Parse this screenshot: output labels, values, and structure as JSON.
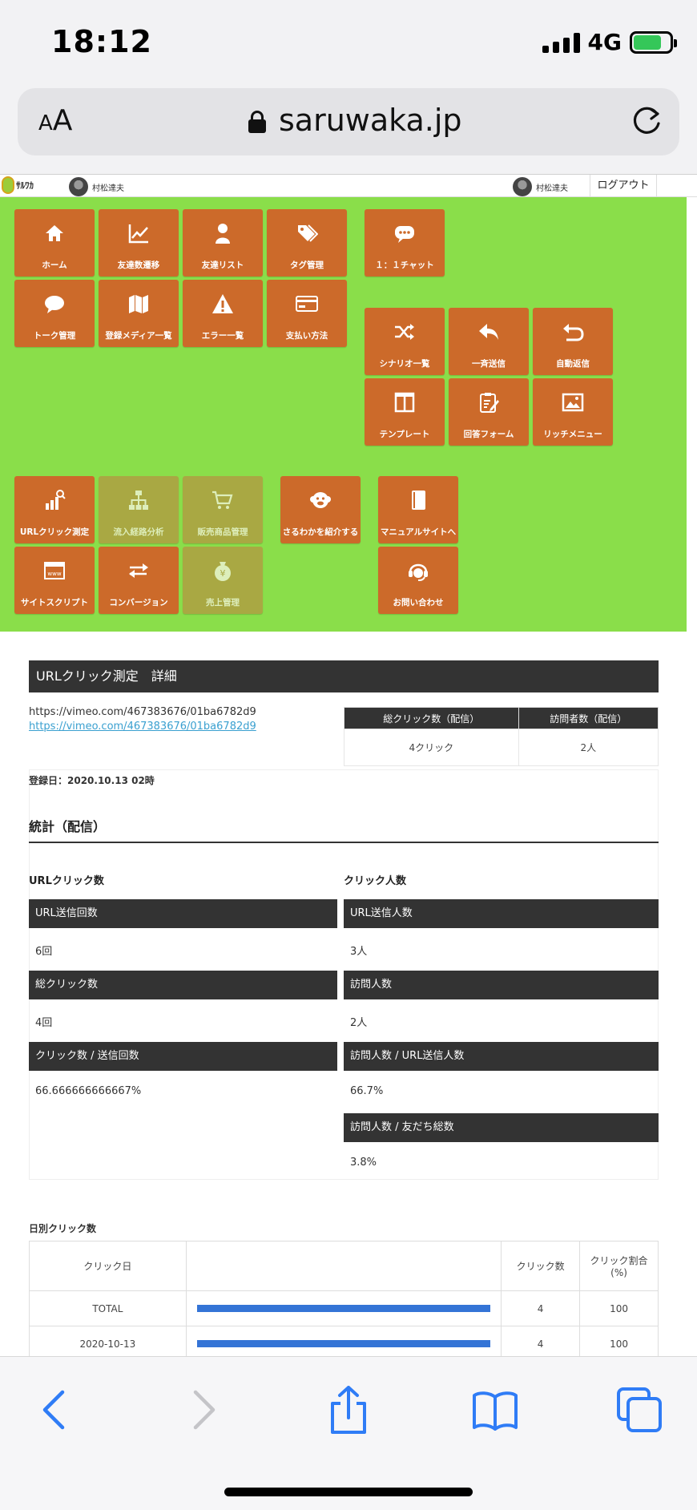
{
  "status_bar": {
    "time": "18:12",
    "network": "4G"
  },
  "browser": {
    "text_size_label_small": "A",
    "text_size_label_large": "A",
    "domain": "saruwaka.jp"
  },
  "header": {
    "logo_text": "ｻﾙﾜｶ",
    "user_name_left": "村松達夫",
    "user_name_right": "村松達夫",
    "logout_label": "ログアウト"
  },
  "nav": {
    "home": "ホーム",
    "friend_trend": "友達数遷移",
    "friend_list": "友達リスト",
    "tag_manage": "タグ管理",
    "chat": "１：１チャット",
    "talk_manage": "トーク管理",
    "media_list": "登録メディア一覧",
    "error_list": "エラー一覧",
    "payment": "支払い方法",
    "scenario_list": "シナリオ一覧",
    "broadcast": "一斉送信",
    "auto_reply": "自動返信",
    "template": "テンプレート",
    "answer_form": "回答フォーム",
    "rich_menu": "リッチメニュー",
    "url_click": "URLクリック測定",
    "inflow_analysis": "流入経路分析",
    "product_manage": "販売商品管理",
    "introduce": "さるわかを紹介する",
    "manual_site": "マニュアルサイトへ",
    "site_script": "サイトスクリプト",
    "conversion": "コンバージョン",
    "sales_manage": "売上管理",
    "contact": "お問い合わせ"
  },
  "detail": {
    "title": "URLクリック測定　詳細",
    "url_text": "https://vimeo.com/467383676/01ba6782d9",
    "url_link": "https://vimeo.com/467383676/01ba6782d9",
    "summary_headers": [
      "総クリック数（配信）",
      "訪問者数（配信）"
    ],
    "summary_values": [
      "4クリック",
      "2人"
    ],
    "registered": "登録日：2020.10.13 02時"
  },
  "stats": {
    "title": "統計（配信）",
    "left_heading": "URLクリック数",
    "right_heading": "クリック人数",
    "left": [
      {
        "label": "URL送信回数",
        "value": "6回"
      },
      {
        "label": "総クリック数",
        "value": "4回"
      },
      {
        "label": "クリック数 / 送信回数",
        "value": "66.666666666667%"
      }
    ],
    "right": [
      {
        "label": "URL送信人数",
        "value": "3人"
      },
      {
        "label": "訪問人数",
        "value": "2人"
      },
      {
        "label": "訪問人数 / URL送信人数",
        "value": "66.7%"
      },
      {
        "label": "訪問人数 / 友だち総数",
        "value": "3.8%"
      }
    ]
  },
  "daily": {
    "title": "日別クリック数",
    "headers": [
      "クリック日",
      "",
      "クリック数",
      "クリック割合(%)"
    ],
    "rows": [
      {
        "date": "TOTAL",
        "count": "4",
        "ratio": "100",
        "bar_fraction": 1.0
      },
      {
        "date": "2020-10-13",
        "count": "4",
        "ratio": "100",
        "bar_fraction": 1.0
      }
    ]
  },
  "colors": {
    "nav_bg": "#8ade4a",
    "tile": "#cc6a2a",
    "tile_muted": "#a9a843",
    "bar": "#3474d6",
    "ios_blue": "#2f7cf6"
  },
  "toolbar_icons": [
    "back-icon",
    "forward-icon",
    "share-icon",
    "bookmarks-icon",
    "tabs-icon"
  ]
}
